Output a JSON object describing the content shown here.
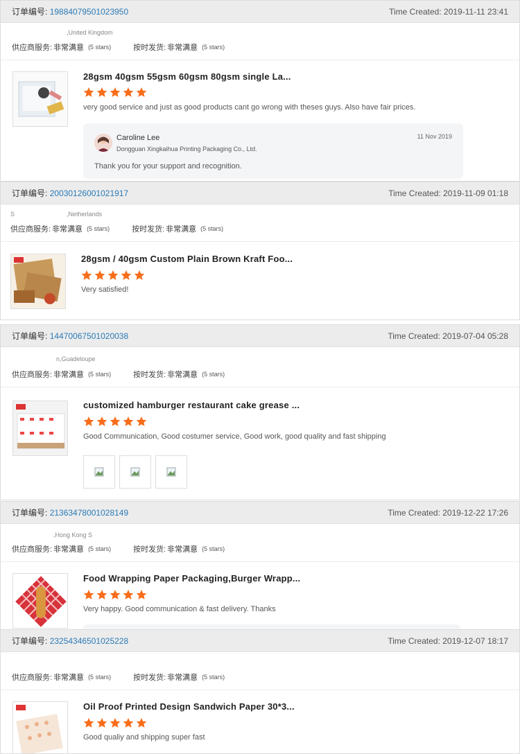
{
  "common": {
    "order_label": "订单编号:",
    "supplier_service_label": "供应商服务:",
    "supplier_service_value": "非常满意",
    "stars_note": "(5 stars)",
    "ontime_label": "按时发货:",
    "ontime_value": "非常满意",
    "star_color": "#f86d1a",
    "link_color": "#2a7ab8"
  },
  "reviews": [
    {
      "order_number": "19884079501023950",
      "time_created": "Time Created: 2019-11-11 23:41",
      "buyer_country": ",United Kingdom",
      "product_title": "28gsm 40gsm 55gsm 60gsm 80gsm single La...",
      "rating": 5,
      "comment": "very good service and just as good products cant go wrong with theses guys. Also have fair prices.",
      "reply": {
        "name": "Caroline Lee",
        "company": "Dongguan Xingkaihua Printing Packaging Co., Ltd.",
        "date": "11 Nov 2019",
        "text": "Thank you for your support and recognition."
      }
    },
    {
      "order_number": "20030126001021917",
      "time_created": "Time Created: 2019-11-09 01:18",
      "buyer_country": ",Netherlands",
      "buyer_prefix": "S",
      "product_title": "28gsm / 40gsm Custom Plain Brown Kraft Foo...",
      "rating": 5,
      "comment": "Very satisfied!"
    },
    {
      "order_number": "14470067501020038",
      "time_created": "Time Created: 2019-07-04 05:28",
      "buyer_country": "n,Guadeloupe",
      "product_title": "customized hamburger restaurant cake grease ...",
      "rating": 5,
      "comment": "Good Communication, Good costumer service, Good work, good quality and fast shipping",
      "photos": [
        "broken-image",
        "broken-image",
        "broken-image"
      ]
    },
    {
      "order_number": "21363478001028149",
      "time_created": "Time Created: 2019-12-22 17:26",
      "buyer_country": ",Hong Kong S",
      "product_title": "Food Wrapping Paper Packaging,Burger Wrapp...",
      "rating": 5,
      "comment": "Very happy. Good communication & fast delivery. Thanks"
    },
    {
      "order_number": "23254346501025228",
      "time_created": "Time Created: 2019-12-07 18:17",
      "buyer_country": "",
      "product_title": "Oil Proof Printed Design Sandwich Paper 30*3...",
      "rating": 5,
      "comment": "Good qualiy and shipping super fast"
    }
  ]
}
